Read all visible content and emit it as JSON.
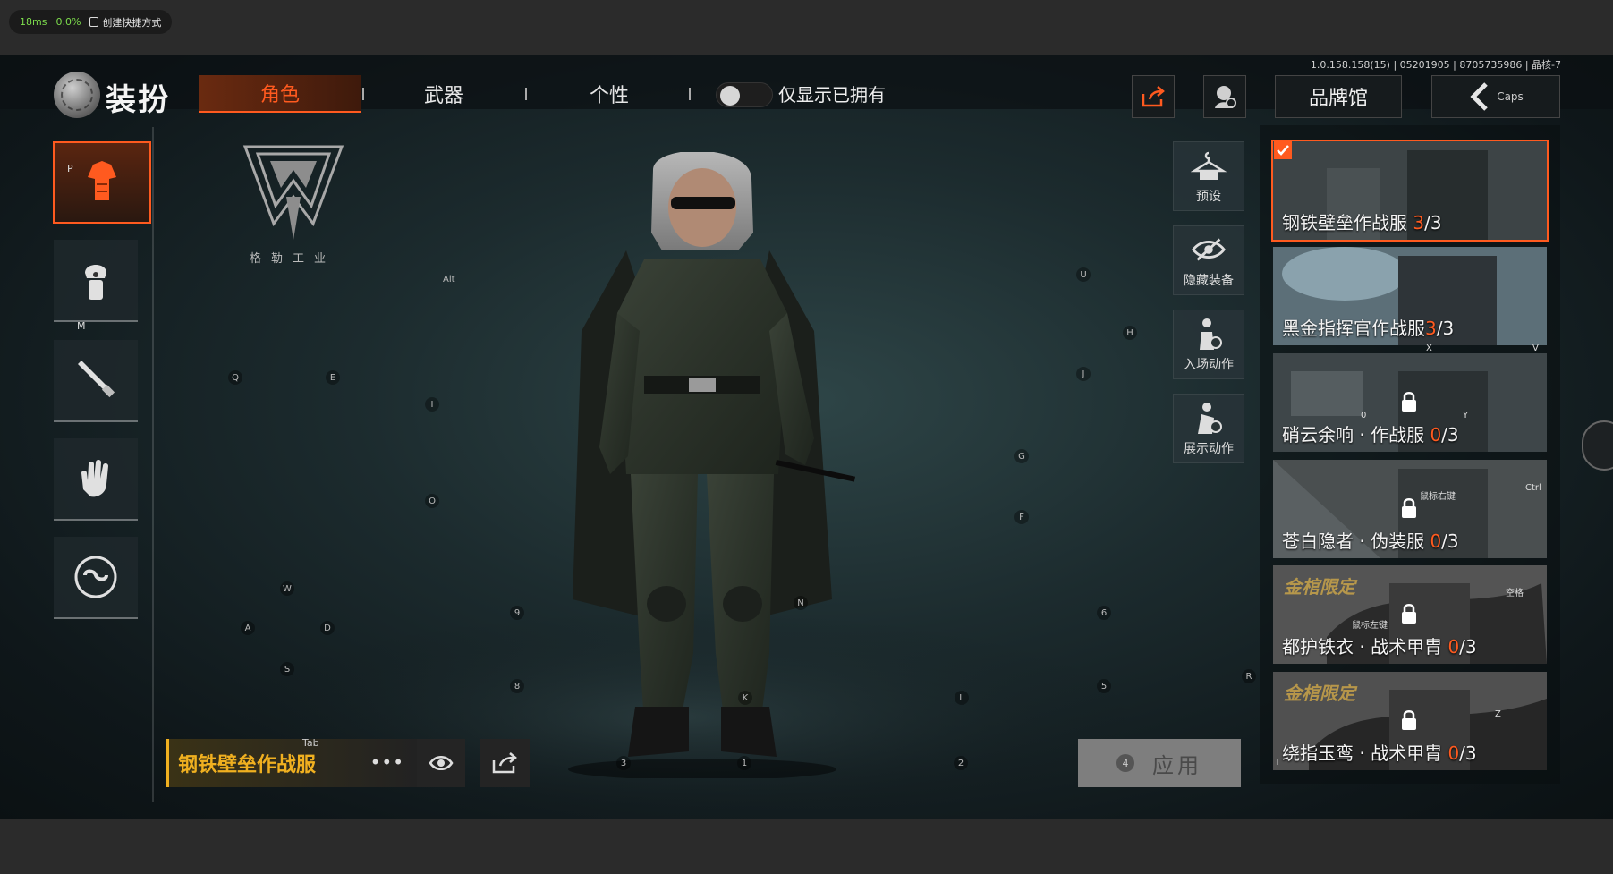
{
  "overlay": {
    "latency": "18ms",
    "loss": "0.0%",
    "shortcut_label": "创建快捷方式"
  },
  "version": "1.0.158.158(15) | 05201905 | 8705735986 | 晶核-7",
  "header": {
    "title": "装扮",
    "tabs": [
      {
        "label": "角色",
        "active": true
      },
      {
        "label": "武器",
        "active": false
      },
      {
        "label": "个性",
        "active": false
      }
    ],
    "owned_only_label": "仅显示已拥有",
    "owned_only_on": false,
    "brand_hall_label": "品牌馆",
    "back_key": "Caps"
  },
  "left_slots": {
    "active_key": "P",
    "second_key": "M"
  },
  "brand_logo_text": "格勒工业",
  "actions": [
    {
      "label": "预设",
      "icon": "hanger-icon"
    },
    {
      "label": "隐藏装备",
      "icon": "eye-slash-icon"
    },
    {
      "label": "入场动作",
      "icon": "entrance-pose-icon"
    },
    {
      "label": "展示动作",
      "icon": "display-pose-icon"
    }
  ],
  "outfits": [
    {
      "name": "钢铁壁垒作战服",
      "owned": "3",
      "total": "/3",
      "selected": true,
      "locked": false,
      "limited": false
    },
    {
      "name": "黑金指挥官作战服",
      "owned": "3",
      "total": "/3",
      "selected": false,
      "locked": false,
      "limited": false
    },
    {
      "name": "硝云余响 · 作战服",
      "owned": "0",
      "total": "/3",
      "selected": false,
      "locked": true,
      "limited": false
    },
    {
      "name": "苍白隐者 · 伪装服",
      "owned": "0",
      "total": "/3",
      "selected": false,
      "locked": true,
      "limited": false
    },
    {
      "name": "都护铁衣 · 战术甲胄",
      "owned": "0",
      "total": "/3",
      "selected": false,
      "locked": true,
      "limited": true
    },
    {
      "name": "绕指玉鸾 · 战术甲胄",
      "owned": "0",
      "total": "/3",
      "selected": false,
      "locked": true,
      "limited": true
    }
  ],
  "limited_tag": "金棺限定",
  "card_keys": {
    "x": "X",
    "v": "V",
    "zero": "0",
    "y": "Y",
    "right_click": "鼠标右键",
    "ctrl": "Ctrl",
    "left_click": "鼠标左键",
    "space": "空格",
    "z": "Z",
    "t": "T"
  },
  "selected_outfit": {
    "name": "钢铁壁垒作战服",
    "more": "•••",
    "tab_key": "Tab"
  },
  "apply": {
    "key": "4",
    "label": "应用"
  },
  "key_hints": {
    "alt": "Alt",
    "q": "Q",
    "e": "E",
    "i": "I",
    "o": "O",
    "w": "W",
    "a": "A",
    "d": "D",
    "s": "S",
    "nine": "9",
    "eight": "8",
    "three": "3",
    "one": "1",
    "k": "K",
    "n": "N",
    "u": "U",
    "h": "H",
    "j": "J",
    "g": "G",
    "f": "F",
    "six": "6",
    "five": "5",
    "l": "L",
    "two": "2",
    "r": "R"
  },
  "colors": {
    "accent": "#ff5a1f",
    "gold": "#f0b020",
    "ok_green": "#7cdc4c"
  }
}
